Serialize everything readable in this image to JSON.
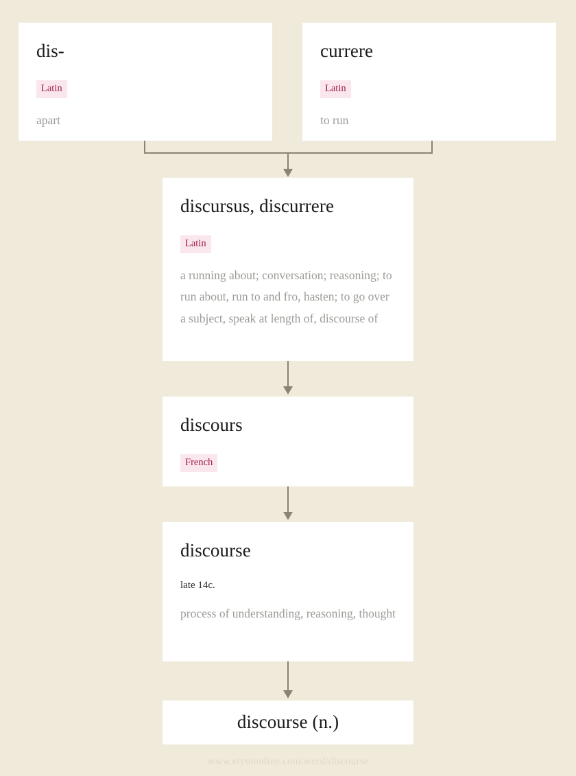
{
  "page": {
    "background_color": "#f0eadb",
    "card_color": "#ffffff",
    "connector_color": "#8a8472",
    "badge_bg_color": "#fae7ee",
    "badge_text_color": "#9e1b45",
    "gloss_color": "#9b9b96",
    "footer_color": "#e0d9c6"
  },
  "nodes": {
    "dis": {
      "title": "dis-",
      "language": "Latin",
      "gloss": "apart"
    },
    "currere": {
      "title": "currere",
      "language": "Latin",
      "gloss": "to run"
    },
    "discursus": {
      "title": "discursus, discurrere",
      "language": "Latin",
      "gloss": "a running about; conversation; reasoning; to run about, run to and fro, hasten; to go over a subject, speak at length of, discourse of"
    },
    "discours": {
      "title": "discours",
      "language": "French"
    },
    "discourse": {
      "title": "discourse",
      "date": "late 14c.",
      "gloss": "process of understanding, reasoning, thought"
    },
    "final": {
      "title": "discourse (n.)"
    }
  },
  "footer": {
    "url": "www.etymonline.com/word/discourse"
  }
}
